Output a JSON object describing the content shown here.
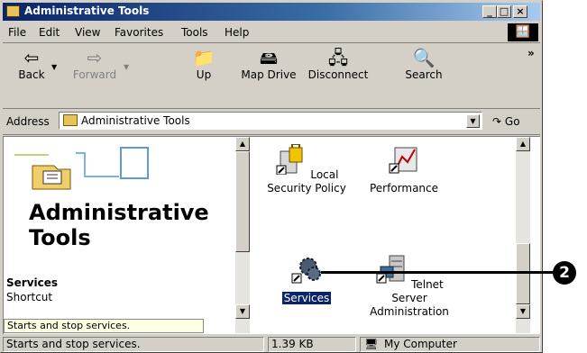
{
  "window": {
    "title": "Administrative Tools"
  },
  "menu": [
    "File",
    "Edit",
    "View",
    "Favorites",
    "Tools",
    "Help"
  ],
  "toolbar": {
    "back": "Back",
    "forward": "Forward",
    "up": "Up",
    "map_drive": "Map Drive",
    "disconnect": "Disconnect",
    "search": "Search",
    "more": "»"
  },
  "address": {
    "label": "Address",
    "value": "Administrative Tools",
    "go": "Go"
  },
  "left_pane": {
    "title": "Administrative Tools",
    "selected_name": "Services",
    "selected_type": "Shortcut",
    "selected_desc": "Starts and stop services."
  },
  "items": [
    {
      "label": "Local Security Policy",
      "icon": "local-security-policy-icon"
    },
    {
      "label": "Performance",
      "icon": "performance-icon"
    },
    {
      "label": "Services",
      "icon": "services-gear-icon",
      "selected": true
    },
    {
      "label": "Telnet Server Administration",
      "icon": "telnet-server-icon"
    }
  ],
  "status": {
    "text": "Starts and stop services.",
    "size": "1.39 KB",
    "location": "My Computer"
  },
  "callout": {
    "number": "2"
  }
}
